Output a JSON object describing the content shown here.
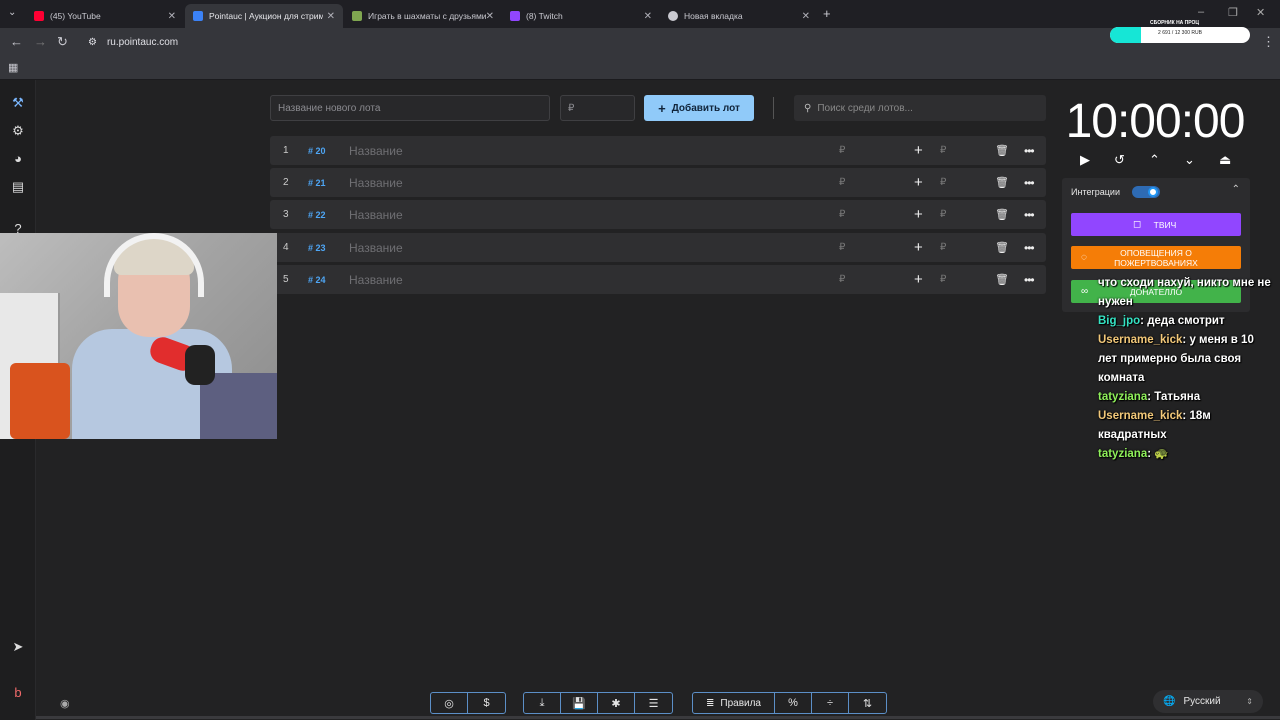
{
  "browser": {
    "tabs": [
      {
        "title": "(45) YouTube",
        "favicon_color": "#ff0033"
      },
      {
        "title": "Pointauc | Аукцион для стрим...",
        "favicon_color": "#3b82f6"
      },
      {
        "title": "Играть в шахматы с друзьями...",
        "favicon_color": "#7fa650"
      },
      {
        "title": "(8) Twitch",
        "favicon_color": "#9146ff"
      },
      {
        "title": "Новая вкладка",
        "favicon_color": "#c9c9d0"
      }
    ],
    "active_tab_index": 1,
    "url": "ru.pointauc.com"
  },
  "donation_overlay": {
    "title": "СБОРНИК НА ПРОЦ",
    "progress_text": "2 691 / 12 300 RUB",
    "progress": 0.22
  },
  "toolbar": {
    "new_lot_placeholder": "Название нового лота",
    "amount_placeholder": "₽",
    "add_label": "Добавить лот",
    "search_placeholder": "Поиск среди лотов..."
  },
  "lots": [
    {
      "num": "1",
      "id": "# 20",
      "name": "Название",
      "currency": "₽"
    },
    {
      "num": "2",
      "id": "# 21",
      "name": "Название",
      "currency": "₽"
    },
    {
      "num": "3",
      "id": "# 22",
      "name": "Название",
      "currency": "₽"
    },
    {
      "num": "4",
      "id": "# 23",
      "name": "Название",
      "currency": "₽"
    },
    {
      "num": "5",
      "id": "# 24",
      "name": "Название",
      "currency": "₽"
    }
  ],
  "timer": {
    "value": "10:00:00"
  },
  "integrations": {
    "label": "Интеграции",
    "enabled": true,
    "buttons": [
      {
        "label": "ТВИЧ",
        "color": "#9146ff"
      },
      {
        "label": "ОПОВЕЩЕНИЯ О ПОЖЕРТВОВАНИЯХ",
        "color": "#f57d07"
      },
      {
        "label": "ДОНАТЕЛЛО",
        "color": "#42b34a"
      }
    ]
  },
  "chat": [
    {
      "user": "",
      "text": "что сходи нахуй, никто мне не нужен"
    },
    {
      "user": "Big_jpo",
      "text": "деда смотрит"
    },
    {
      "user": "Username_kick",
      "text": "у меня в 10 лет примерно была своя комната"
    },
    {
      "user": "tatyziana",
      "text": "Татьяна"
    },
    {
      "user": "Username_kick",
      "text": "18м квадратных"
    },
    {
      "user": "tatyziana",
      "text": "🐢"
    }
  ],
  "bottom": {
    "rules_label": "Правила",
    "language": "Русский"
  }
}
